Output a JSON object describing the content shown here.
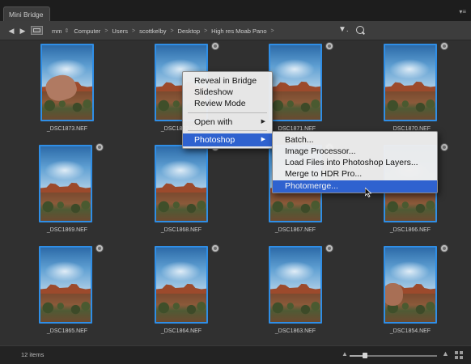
{
  "window": {
    "tab_title": "Mini Bridge",
    "tab_menu_icon": "flyout-menu-icon"
  },
  "pathbar": {
    "back_icon": "back-arrow-icon",
    "forward_icon": "forward-arrow-icon",
    "crumbs": [
      "Computer",
      "Users",
      "scottkelby",
      "Desktop",
      "High res Moab Pano"
    ],
    "root_label": "mm",
    "filter_icon": "filter-icon",
    "search_icon": "search-icon"
  },
  "files": [
    "_DSC1873.NEF",
    "_DSC1872.NEF",
    "_DSC1871.NEF",
    "_DSC1870.NEF",
    "_DSC1869.NEF",
    "_DSC1868.NEF",
    "_DSC1867.NEF",
    "_DSC1866.NEF",
    "_DSC1865.NEF",
    "_DSC1864.NEF",
    "_DSC1863.NEF",
    "_DSC1854.NEF"
  ],
  "context_menu": {
    "items": [
      "Reveal in Bridge",
      "Slideshow",
      "Review Mode",
      "Open with",
      "Photoshop"
    ],
    "selected": "Photoshop",
    "submenu_arrow": "▶"
  },
  "submenu": {
    "items": [
      "Batch...",
      "Image Processor...",
      "Load Files into Photoshop Layers...",
      "Merge to HDR Pro...",
      "Photomerge..."
    ],
    "highlighted": "Photomerge..."
  },
  "status": {
    "item_count": "12 items",
    "zoom_level": 0.18
  },
  "colors": {
    "accent": "#2f62cf",
    "thumb_border": "#2f8ee6",
    "panel_bg": "#303030"
  }
}
